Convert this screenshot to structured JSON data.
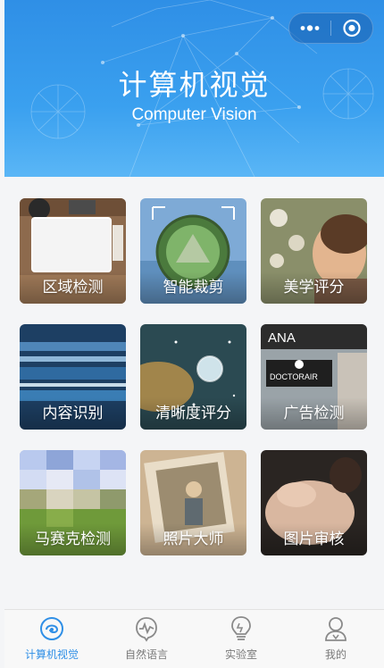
{
  "header": {
    "title": "计算机视觉",
    "subtitle": "Computer Vision",
    "bg_color": "#3aa0ef"
  },
  "capsule": {
    "more_icon": "more-dots-icon",
    "close_icon": "target-close-icon"
  },
  "features": [
    {
      "label": "区域检测"
    },
    {
      "label": "智能裁剪"
    },
    {
      "label": "美学评分"
    },
    {
      "label": "内容识别"
    },
    {
      "label": "清晰度评分"
    },
    {
      "label": "广告检测"
    },
    {
      "label": "马赛克检测"
    },
    {
      "label": "照片大师"
    },
    {
      "label": "图片审核"
    }
  ],
  "ad_card_text": {
    "top": "ANA",
    "brand": "DOCTORAIR"
  },
  "tabbar": {
    "active_color": "#2f8fe6",
    "items": [
      {
        "label": "计算机视觉",
        "icon": "eye-swirl-icon",
        "active": true
      },
      {
        "label": "自然语言",
        "icon": "speech-wave-icon",
        "active": false
      },
      {
        "label": "实验室",
        "icon": "bulb-icon",
        "active": false
      },
      {
        "label": "我的",
        "icon": "user-icon",
        "active": false
      }
    ]
  }
}
